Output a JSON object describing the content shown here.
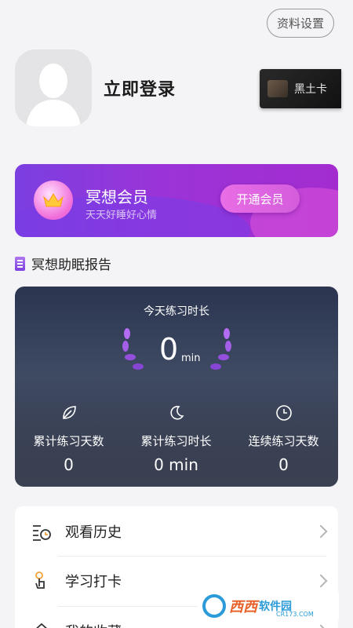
{
  "header": {
    "settings_label": "资料设置"
  },
  "profile": {
    "login_label": "立即登录",
    "card_label": "黑土卡"
  },
  "vip": {
    "title": "冥想会员",
    "subtitle": "天天好睡好心情",
    "button_label": "开通会员"
  },
  "report": {
    "heading": "冥想助眠报告",
    "today_label": "今天练习时长",
    "today_value": "0",
    "today_unit": "min",
    "stats": [
      {
        "label": "累计练习天数",
        "value": "0",
        "icon": "leaf-icon"
      },
      {
        "label": "累计练习时长",
        "value": "0 min",
        "icon": "moon-icon"
      },
      {
        "label": "连续练习天数",
        "value": "0",
        "icon": "clock-icon"
      }
    ]
  },
  "menu": {
    "items": [
      {
        "label": "观看历史",
        "icon": "history-icon"
      },
      {
        "label": "学习打卡",
        "icon": "checkin-icon"
      },
      {
        "label": "我的收藏",
        "icon": "favorites-icon"
      }
    ]
  },
  "watermark": {
    "name": "西西",
    "soft": "软件园",
    "url": "CR173.COM"
  },
  "colors": {
    "vip_start": "#7b3fe0",
    "vip_end": "#a32ccf",
    "accent_pink": "#e96ee6",
    "laurel": "#b36cf2"
  }
}
